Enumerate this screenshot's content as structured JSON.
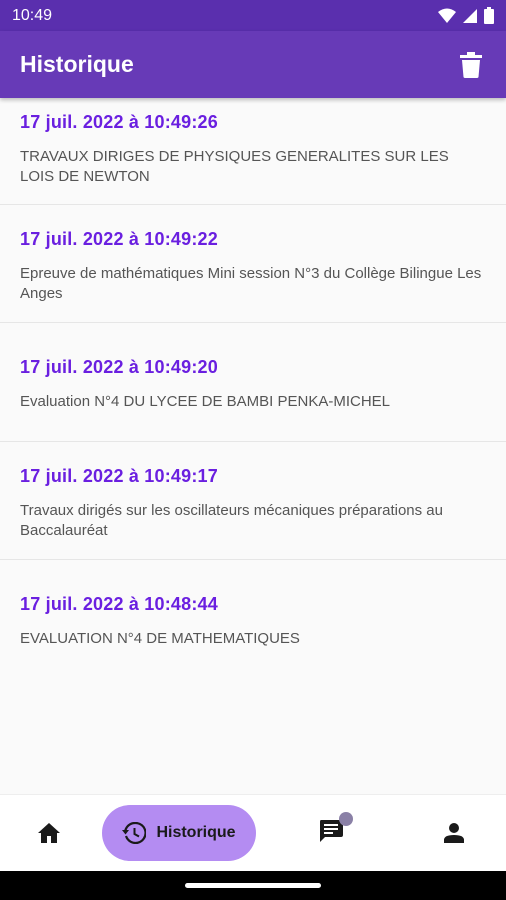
{
  "status_bar": {
    "time": "10:49"
  },
  "app_bar": {
    "title": "Historique"
  },
  "history": [
    {
      "date": "17 juil. 2022  à  10:49:26",
      "description": "TRAVAUX DIRIGES DE PHYSIQUES GENERALITES SUR LES LOIS DE NEWTON"
    },
    {
      "date": "17 juil. 2022  à  10:49:22",
      "description": "Epreuve de mathématiques Mini session N°3 du Collège Bilingue Les Anges"
    },
    {
      "date": "17 juil. 2022  à  10:49:20",
      "description": "Evaluation N°4 DU LYCEE DE BAMBI PENKA-MICHEL"
    },
    {
      "date": "17 juil. 2022  à  10:49:17",
      "description": "Travaux dirigés  sur les oscillateurs mécaniques préparations au Baccalauréat"
    },
    {
      "date": "17 juil. 2022  à  10:48:44",
      "description": "EVALUATION N°4 DE MATHEMATIQUES"
    }
  ],
  "bottom_nav": {
    "items": [
      {
        "icon": "home-icon"
      },
      {
        "icon": "history-icon",
        "label": "Historique"
      },
      {
        "icon": "chat-icon"
      },
      {
        "icon": "person-icon"
      }
    ]
  },
  "colors": {
    "primary": "#673ab7",
    "accent_text": "#6a1fe0",
    "active_pill": "#b48cf2"
  }
}
